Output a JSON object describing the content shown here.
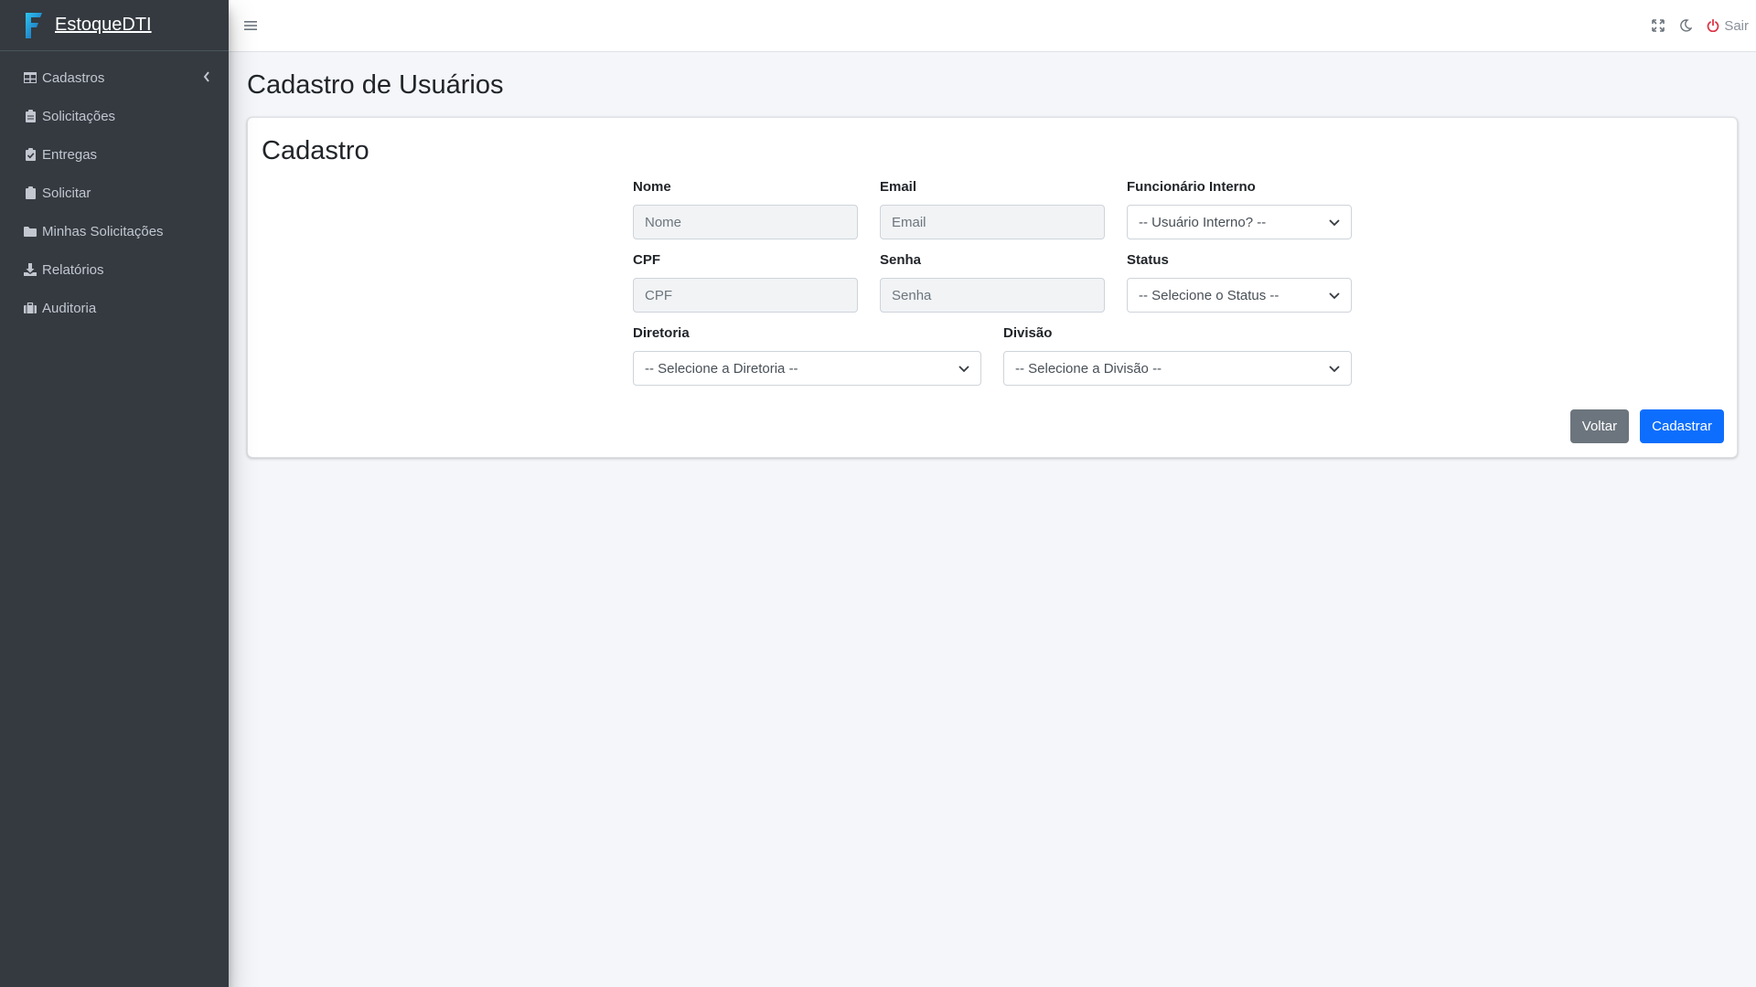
{
  "app": {
    "brand": "EstoqueDTI"
  },
  "sidebar": {
    "items": [
      {
        "label": "Cadastros",
        "icon": "table-icon",
        "has_arrow": true
      },
      {
        "label": "Solicitações",
        "icon": "clipboard-icon"
      },
      {
        "label": "Entregas",
        "icon": "clipboard-check-icon"
      },
      {
        "label": "Solicitar",
        "icon": "clipboard-icon"
      },
      {
        "label": "Minhas Solicitações",
        "icon": "folder-icon"
      },
      {
        "label": "Relatórios",
        "icon": "download-icon"
      },
      {
        "label": "Auditoria",
        "icon": "briefcase-icon"
      }
    ]
  },
  "topbar": {
    "logout_label": "Sair",
    "icons": [
      "hamburger-icon",
      "fullscreen-icon",
      "moon-icon",
      "power-icon"
    ]
  },
  "page": {
    "title": "Cadastro de Usuários"
  },
  "card": {
    "title": "Cadastro"
  },
  "form": {
    "nome": {
      "label": "Nome",
      "placeholder": "Nome"
    },
    "email": {
      "label": "Email",
      "placeholder": "Email"
    },
    "funcionario": {
      "label": "Funcionário Interno",
      "selected": "-- Usuário Interno? --"
    },
    "cpf": {
      "label": "CPF",
      "placeholder": "CPF"
    },
    "senha": {
      "label": "Senha",
      "placeholder": "Senha"
    },
    "status": {
      "label": "Status",
      "selected": "-- Selecione o Status --"
    },
    "diretoria": {
      "label": "Diretoria",
      "selected": "-- Selecione a Diretoria --"
    },
    "divisao": {
      "label": "Divisão",
      "selected": "-- Selecione a Divisão --"
    }
  },
  "actions": {
    "back_label": "Voltar",
    "submit_label": "Cadastrar"
  },
  "colors": {
    "sidebar_bg": "#343a40",
    "primary": "#0d6efd",
    "secondary": "#6c757d",
    "logout_icon": "#dc3545"
  }
}
